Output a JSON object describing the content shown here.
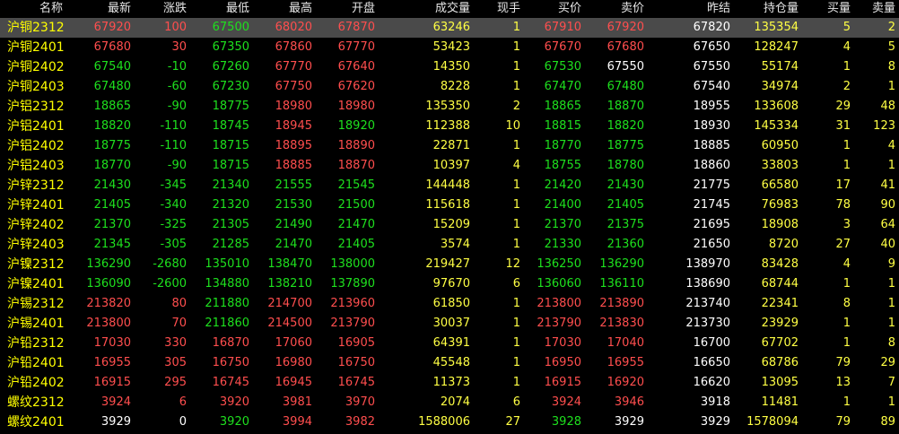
{
  "colors": {
    "up": "#ff4e4e",
    "down": "#1ee01e",
    "flat": "#ffffff",
    "name": "#ffff00",
    "volume": "#ffff44",
    "header": "#e6e6e6",
    "selected_bg": "#4a4a4a",
    "background": "#000000"
  },
  "headers": {
    "name": "名称",
    "last": "最新",
    "change": "涨跌",
    "low": "最低",
    "high": "最高",
    "open": "开盘",
    "volume": "成交量",
    "tick_vol": "现手",
    "bid": "买价",
    "ask": "卖价",
    "prev_settle": "昨结",
    "open_interest": "持仓量",
    "bid_vol": "买量",
    "ask_vol": "卖量"
  },
  "rows": [
    {
      "name": "沪铜2312",
      "last": "67920",
      "change": "100",
      "low": "67500",
      "high": "68020",
      "open": "67870",
      "volume": "63246",
      "tick_vol": "1",
      "bid": "67910",
      "ask": "67920",
      "prev_settle": "67820",
      "open_interest": "135354",
      "bid_vol": "5",
      "ask_vol": "2"
    },
    {
      "name": "沪铜2401",
      "last": "67680",
      "change": "30",
      "low": "67350",
      "high": "67860",
      "open": "67770",
      "volume": "53423",
      "tick_vol": "1",
      "bid": "67670",
      "ask": "67680",
      "prev_settle": "67650",
      "open_interest": "128247",
      "bid_vol": "4",
      "ask_vol": "5"
    },
    {
      "name": "沪铜2402",
      "last": "67540",
      "change": "-10",
      "low": "67260",
      "high": "67770",
      "open": "67640",
      "volume": "14350",
      "tick_vol": "1",
      "bid": "67530",
      "ask": "67550",
      "prev_settle": "67550",
      "open_interest": "55174",
      "bid_vol": "1",
      "ask_vol": "8"
    },
    {
      "name": "沪铜2403",
      "last": "67480",
      "change": "-60",
      "low": "67230",
      "high": "67750",
      "open": "67620",
      "volume": "8228",
      "tick_vol": "1",
      "bid": "67470",
      "ask": "67480",
      "prev_settle": "67540",
      "open_interest": "34974",
      "bid_vol": "2",
      "ask_vol": "1"
    },
    {
      "name": "沪铝2312",
      "last": "18865",
      "change": "-90",
      "low": "18775",
      "high": "18980",
      "open": "18980",
      "volume": "135350",
      "tick_vol": "2",
      "bid": "18865",
      "ask": "18870",
      "prev_settle": "18955",
      "open_interest": "133608",
      "bid_vol": "29",
      "ask_vol": "48"
    },
    {
      "name": "沪铝2401",
      "last": "18820",
      "change": "-110",
      "low": "18745",
      "high": "18945",
      "open": "18920",
      "volume": "112388",
      "tick_vol": "10",
      "bid": "18815",
      "ask": "18820",
      "prev_settle": "18930",
      "open_interest": "145334",
      "bid_vol": "31",
      "ask_vol": "123"
    },
    {
      "name": "沪铝2402",
      "last": "18775",
      "change": "-110",
      "low": "18715",
      "high": "18895",
      "open": "18890",
      "volume": "22871",
      "tick_vol": "1",
      "bid": "18770",
      "ask": "18775",
      "prev_settle": "18885",
      "open_interest": "60950",
      "bid_vol": "1",
      "ask_vol": "4"
    },
    {
      "name": "沪铝2403",
      "last": "18770",
      "change": "-90",
      "low": "18715",
      "high": "18885",
      "open": "18870",
      "volume": "10397",
      "tick_vol": "4",
      "bid": "18755",
      "ask": "18780",
      "prev_settle": "18860",
      "open_interest": "33803",
      "bid_vol": "1",
      "ask_vol": "1"
    },
    {
      "name": "沪锌2312",
      "last": "21430",
      "change": "-345",
      "low": "21340",
      "high": "21555",
      "open": "21545",
      "volume": "144448",
      "tick_vol": "1",
      "bid": "21420",
      "ask": "21430",
      "prev_settle": "21775",
      "open_interest": "66580",
      "bid_vol": "17",
      "ask_vol": "41"
    },
    {
      "name": "沪锌2401",
      "last": "21405",
      "change": "-340",
      "low": "21320",
      "high": "21530",
      "open": "21500",
      "volume": "115618",
      "tick_vol": "1",
      "bid": "21400",
      "ask": "21405",
      "prev_settle": "21745",
      "open_interest": "76983",
      "bid_vol": "78",
      "ask_vol": "90"
    },
    {
      "name": "沪锌2402",
      "last": "21370",
      "change": "-325",
      "low": "21305",
      "high": "21490",
      "open": "21470",
      "volume": "15209",
      "tick_vol": "1",
      "bid": "21370",
      "ask": "21375",
      "prev_settle": "21695",
      "open_interest": "18908",
      "bid_vol": "3",
      "ask_vol": "64"
    },
    {
      "name": "沪锌2403",
      "last": "21345",
      "change": "-305",
      "low": "21285",
      "high": "21470",
      "open": "21405",
      "volume": "3574",
      "tick_vol": "1",
      "bid": "21330",
      "ask": "21360",
      "prev_settle": "21650",
      "open_interest": "8720",
      "bid_vol": "27",
      "ask_vol": "40"
    },
    {
      "name": "沪镍2312",
      "last": "136290",
      "change": "-2680",
      "low": "135010",
      "high": "138470",
      "open": "138000",
      "volume": "219427",
      "tick_vol": "12",
      "bid": "136250",
      "ask": "136290",
      "prev_settle": "138970",
      "open_interest": "83428",
      "bid_vol": "4",
      "ask_vol": "9"
    },
    {
      "name": "沪镍2401",
      "last": "136090",
      "change": "-2600",
      "low": "134880",
      "high": "138210",
      "open": "137890",
      "volume": "97670",
      "tick_vol": "6",
      "bid": "136060",
      "ask": "136110",
      "prev_settle": "138690",
      "open_interest": "68744",
      "bid_vol": "1",
      "ask_vol": "1"
    },
    {
      "name": "沪锡2312",
      "last": "213820",
      "change": "80",
      "low": "211880",
      "high": "214700",
      "open": "213960",
      "volume": "61850",
      "tick_vol": "1",
      "bid": "213800",
      "ask": "213890",
      "prev_settle": "213740",
      "open_interest": "22341",
      "bid_vol": "8",
      "ask_vol": "1"
    },
    {
      "name": "沪锡2401",
      "last": "213800",
      "change": "70",
      "low": "211860",
      "high": "214500",
      "open": "213790",
      "volume": "30037",
      "tick_vol": "1",
      "bid": "213790",
      "ask": "213830",
      "prev_settle": "213730",
      "open_interest": "23929",
      "bid_vol": "1",
      "ask_vol": "1"
    },
    {
      "name": "沪铅2312",
      "last": "17030",
      "change": "330",
      "low": "16870",
      "high": "17060",
      "open": "16905",
      "volume": "64391",
      "tick_vol": "1",
      "bid": "17030",
      "ask": "17040",
      "prev_settle": "16700",
      "open_interest": "67702",
      "bid_vol": "1",
      "ask_vol": "8"
    },
    {
      "name": "沪铅2401",
      "last": "16955",
      "change": "305",
      "low": "16750",
      "high": "16980",
      "open": "16750",
      "volume": "45548",
      "tick_vol": "1",
      "bid": "16950",
      "ask": "16955",
      "prev_settle": "16650",
      "open_interest": "68786",
      "bid_vol": "79",
      "ask_vol": "29"
    },
    {
      "name": "沪铅2402",
      "last": "16915",
      "change": "295",
      "low": "16745",
      "high": "16945",
      "open": "16745",
      "volume": "11373",
      "tick_vol": "1",
      "bid": "16915",
      "ask": "16920",
      "prev_settle": "16620",
      "open_interest": "13095",
      "bid_vol": "13",
      "ask_vol": "7"
    },
    {
      "name": "螺纹2312",
      "last": "3924",
      "change": "6",
      "low": "3920",
      "high": "3981",
      "open": "3970",
      "volume": "2074",
      "tick_vol": "6",
      "bid": "3924",
      "ask": "3946",
      "prev_settle": "3918",
      "open_interest": "11481",
      "bid_vol": "1",
      "ask_vol": "1"
    },
    {
      "name": "螺纹2401",
      "last": "3929",
      "change": "0",
      "low": "3920",
      "high": "3994",
      "open": "3982",
      "volume": "1588006",
      "tick_vol": "27",
      "bid": "3928",
      "ask": "3929",
      "prev_settle": "3929",
      "open_interest": "1578094",
      "bid_vol": "79",
      "ask_vol": "89"
    }
  ]
}
